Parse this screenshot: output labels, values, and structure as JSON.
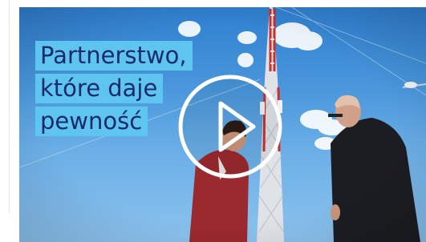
{
  "video": {
    "headline_lines": [
      "Partnerstwo,",
      "które daje",
      "pewność"
    ]
  },
  "icons": {
    "play": "play-icon"
  },
  "colors": {
    "headline_bg": "#5ec5f0",
    "headline_text": "#1a2a6c",
    "sky_top": "#2f7fcf",
    "sky_bottom": "#8cc3ee"
  }
}
